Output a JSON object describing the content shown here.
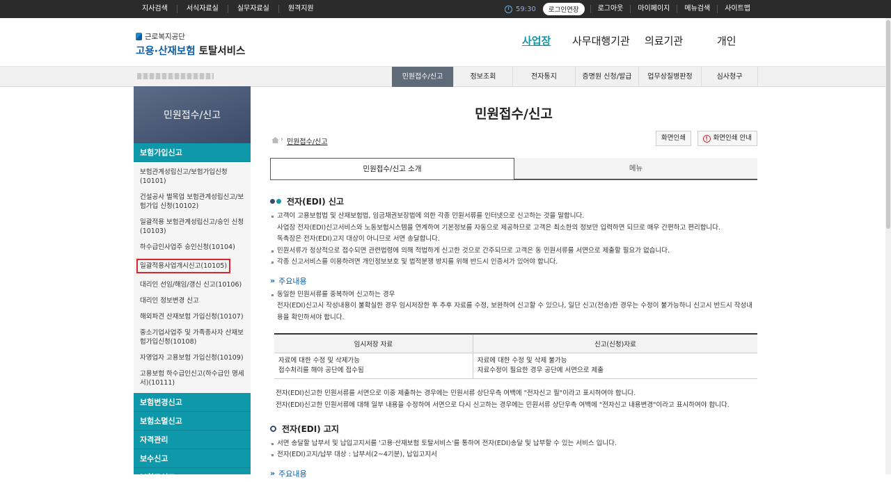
{
  "topbar": {
    "left_links": [
      "지사검색",
      "서식자료실",
      "실무자료실",
      "원격지원"
    ],
    "time": "59:30",
    "extend_label": "로그인연장",
    "right_links": [
      "로그아웃",
      "마이페이지",
      "메뉴검색",
      "사이트맵"
    ]
  },
  "logo": {
    "line1": "근로복지공단",
    "line2a": "고용·산재보험",
    "line2b": "토탈서비스"
  },
  "gnav": [
    "사업장",
    "사무대행기관",
    "의료기관",
    "개인"
  ],
  "menubar": [
    "민원접수/신고",
    "정보조회",
    "전자통지",
    "증명원 신청/발급",
    "업무상질병판정",
    "심사청구"
  ],
  "sidebar": {
    "title": "민원접수/신고",
    "category_active": "보험가입신고",
    "items": [
      "보험관계성립신고/보험가입신청(10101)",
      "건설공사 벌목업 보험관계성립신고/보험가입 신청(10102)",
      "일괄적용 보험관계성립신고/승인 신청(10103)",
      "하수급인사업주 승인신청(10104)",
      "일괄적용사업개시신고(10105)",
      "대리인 선임/해임/갱신 신고(10106)",
      "대리인 정보변경 신고",
      "해외파견 산재보험 가입신청(10107)",
      "중소기업사업주 및 가족종사자 산재보험가입신청(10108)",
      "자영업자 고용보험 가입신청(10109)",
      "고용보험 하수급인신고(하수급인 명세서)(10111)"
    ],
    "categories": [
      "보험변경신고",
      "보험소멸신고",
      "자격관리",
      "보수신고",
      "보험료신고"
    ]
  },
  "content": {
    "title": "민원접수/신고",
    "breadcrumb": "민원접수/신고",
    "print_btn": "화면인쇄",
    "print_guide_btn": "화면인쇄 안내",
    "tabs": [
      "민원접수/신고 소개",
      "메뉴"
    ],
    "sec1_title": "전자(EDI) 신고",
    "sec1_bullets": [
      "고객이 고용보험법 및 산재보험법, 임금채권보장법에 의한 각종 민원서류를 인터넷으로 신고하는 것을 말합니다.",
      "사업장 전자(EDI)신고서비스와 노동보험시스템을 연계하여 기본정보를 자동으로 제공하므로 고객은 최소한의 정보만 입력하면 되므로 매우 간편하고 편리합니다.",
      "독촉장은 전자(EDI)고지 대상이 아니므로 서면 송달합니다.",
      "민원서류가 정상적으로 접수되면 관련법령에 의해 적법하게 신고한 것으로 간주되므로 고객은 동 민원서류를 서면으로 제출할 필요가 없습니다.",
      "각종 신고서비스를 이용하려면 개인정보보호 및 법적분쟁 방지를 위해 반드시 인증서가 있어야 합니다."
    ],
    "main_label": "주요내용",
    "main_bullets": [
      "동일한 민원서류를 중복하여 신고하는 경우",
      "전자(EDI)신고시 작성내용이 불확실한 경우 임시저장한 후 추후 자료를 수정, 보완하여 신고할 수 있으나, 일단 신고(전송)한 경우는 수정이 불가능하니 신고시 반드시 작성내용을 확인하셔야 합니다."
    ],
    "table": {
      "headers": [
        "임시저장 자료",
        "신고(신청)자료"
      ],
      "col1": [
        "자료에 대한 수정 및 삭제가능",
        "접수처리를 해야 공단에 접수됨"
      ],
      "col2": [
        "자료에 대한 수정 및 삭제 불가능",
        "자료수정이 필요한 경우 공단에 서면으로 제출"
      ]
    },
    "notes": [
      "전자(EDI)신고한 민원서류를 서면으로 이중 제출하는 경우에는 민원서류 상단우측 여백에 \"전자신고 필\"이라고 표시하여야 합니다.",
      "전자(EDI)신고한 민원서류에 대해 일부 내용을 수정하여 서면으로 다시 신고하는 경우에는 민원서류 상단우측 여백에 \"전자신고 내용변경\"이라고 표시하여야 합니다."
    ],
    "sec2_title": "전자(EDI) 고지",
    "sec2_bullets": [
      "서면 송달할 납부서 및 납입고지서를 '고용·산재보험 토탈서비스'를 통하여 전자(EDI)송달 및 납부할 수 있는 서비스 입니다.",
      "전자(EDI)고지/납부 대상 : 납부서(2~4기분), 납입고지서"
    ],
    "main_label2": "주요내용"
  }
}
